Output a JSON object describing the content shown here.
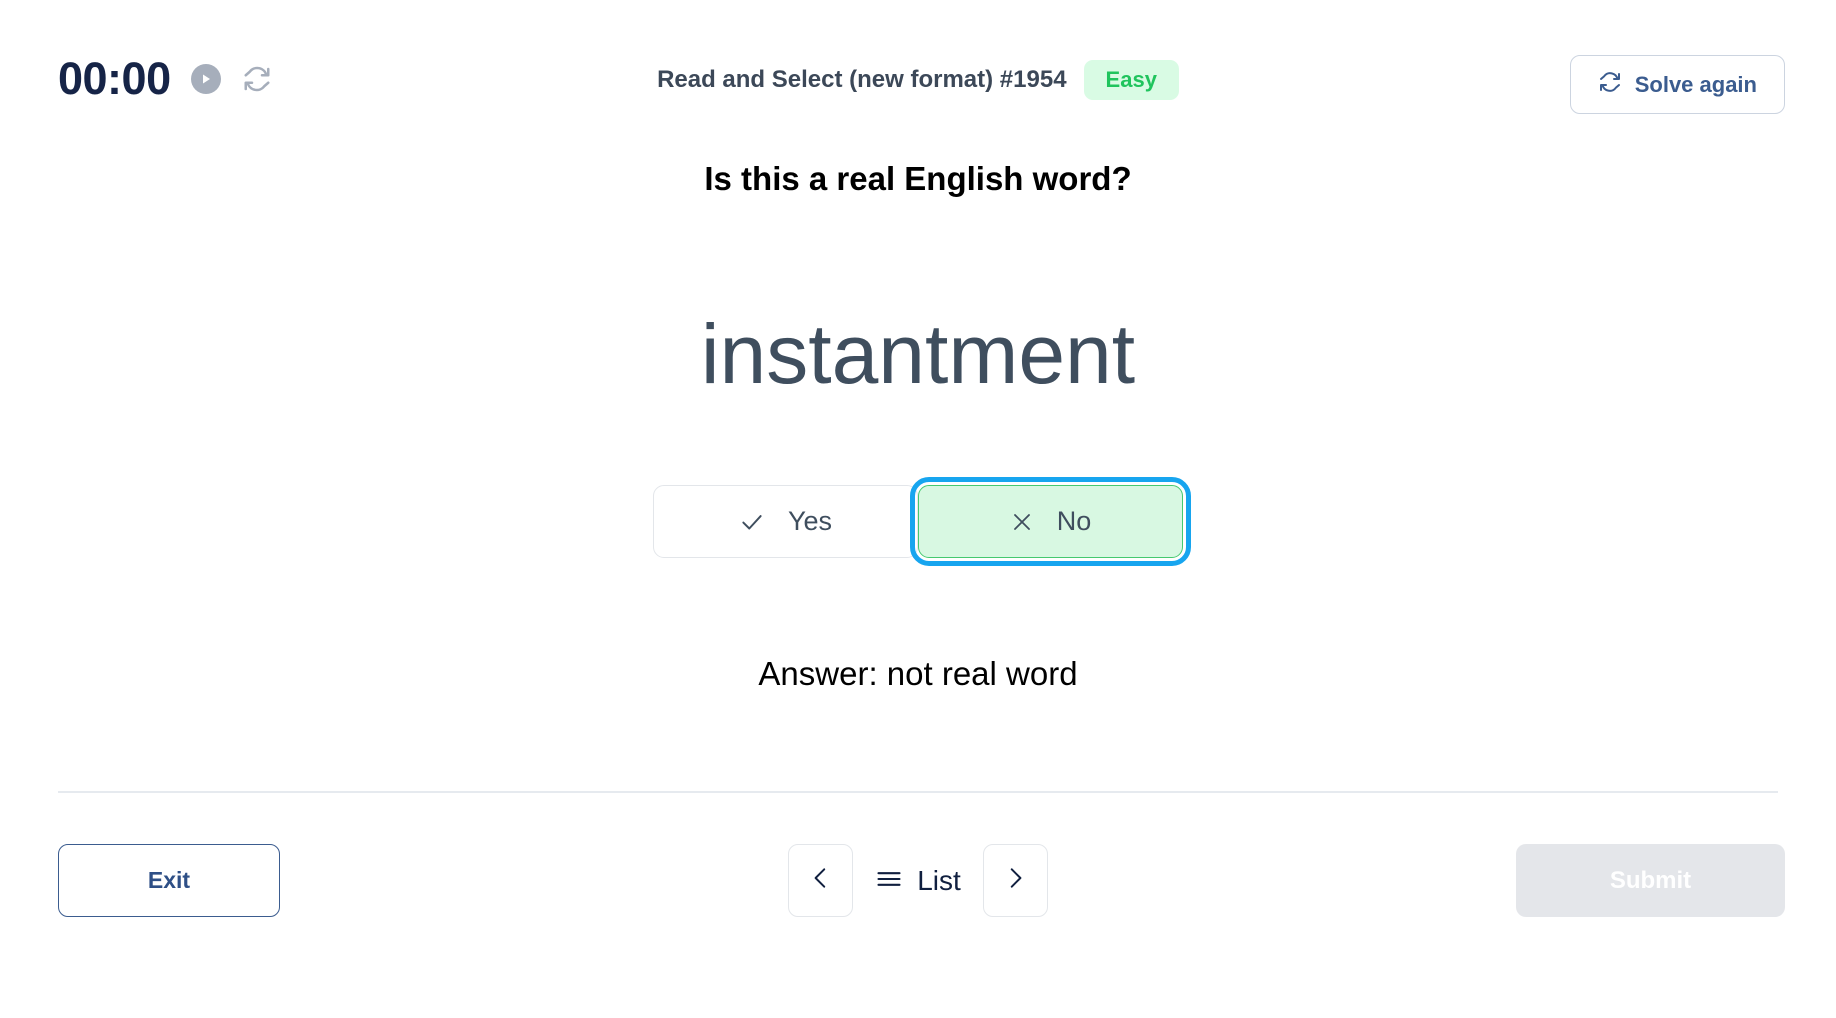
{
  "header": {
    "timer": {
      "value": "00:00",
      "play_icon": "play-circle-icon",
      "reset_icon": "refresh-icon"
    },
    "puzzle_title": "Read and Select (new format) #1954",
    "difficulty": "Easy",
    "solve_again": {
      "label": "Solve again",
      "icon": "refresh-icon"
    }
  },
  "main": {
    "question": "Is this a real English word?",
    "word": "instantment",
    "choices": [
      {
        "label": "Yes",
        "icon": "check-icon",
        "selected": false
      },
      {
        "label": "No",
        "icon": "cross-icon",
        "selected": true
      }
    ],
    "answer": "Answer: not real word"
  },
  "footer": {
    "exit_label": "Exit",
    "prev_icon": "chevron-left-icon",
    "next_icon": "chevron-right-icon",
    "list_label": "List",
    "list_icon": "hamburger-icon",
    "submit_label": "Submit"
  },
  "colors": {
    "accent_navy": "#162447",
    "link_blue": "#3b5c8f",
    "badge_green_text": "#20c45d",
    "badge_green_bg": "#d9fbe4",
    "selected_bg": "#d8f8e2",
    "selected_border": "#45c96f",
    "focus_ring": "#17a5ef",
    "word_gray": "#3f4e5e",
    "disabled_bg": "#e4e6ea"
  }
}
